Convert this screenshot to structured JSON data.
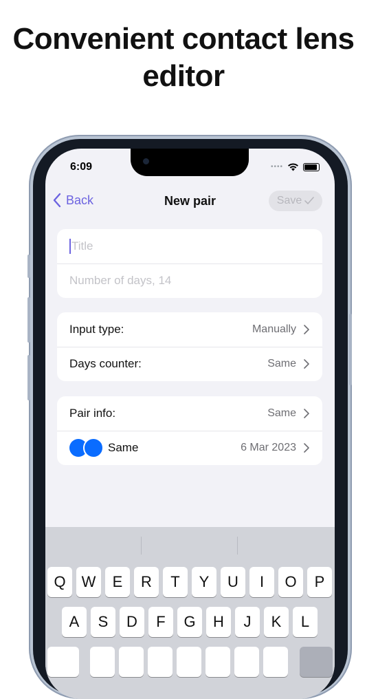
{
  "headline": "Convenient contact lens editor",
  "status": {
    "time": "6:09"
  },
  "nav": {
    "back_label": "Back",
    "title": "New pair",
    "save_label": "Save"
  },
  "form": {
    "title_placeholder": "Title",
    "days_placeholder": "Number of days, 14"
  },
  "settings": {
    "input_type_label": "Input type:",
    "input_type_value": "Manually",
    "days_counter_label": "Days counter:",
    "days_counter_value": "Same"
  },
  "pair": {
    "info_label": "Pair info:",
    "info_value": "Same",
    "name": "Same",
    "date": "6 Mar 2023",
    "lens_color": "#0a6cff"
  },
  "keyboard": {
    "row1": [
      "Q",
      "W",
      "E",
      "R",
      "T",
      "Y",
      "U",
      "I",
      "O",
      "P"
    ],
    "row2": [
      "A",
      "S",
      "D",
      "F",
      "G",
      "H",
      "J",
      "K",
      "L"
    ]
  },
  "colors": {
    "accent": "#6c63e0"
  }
}
